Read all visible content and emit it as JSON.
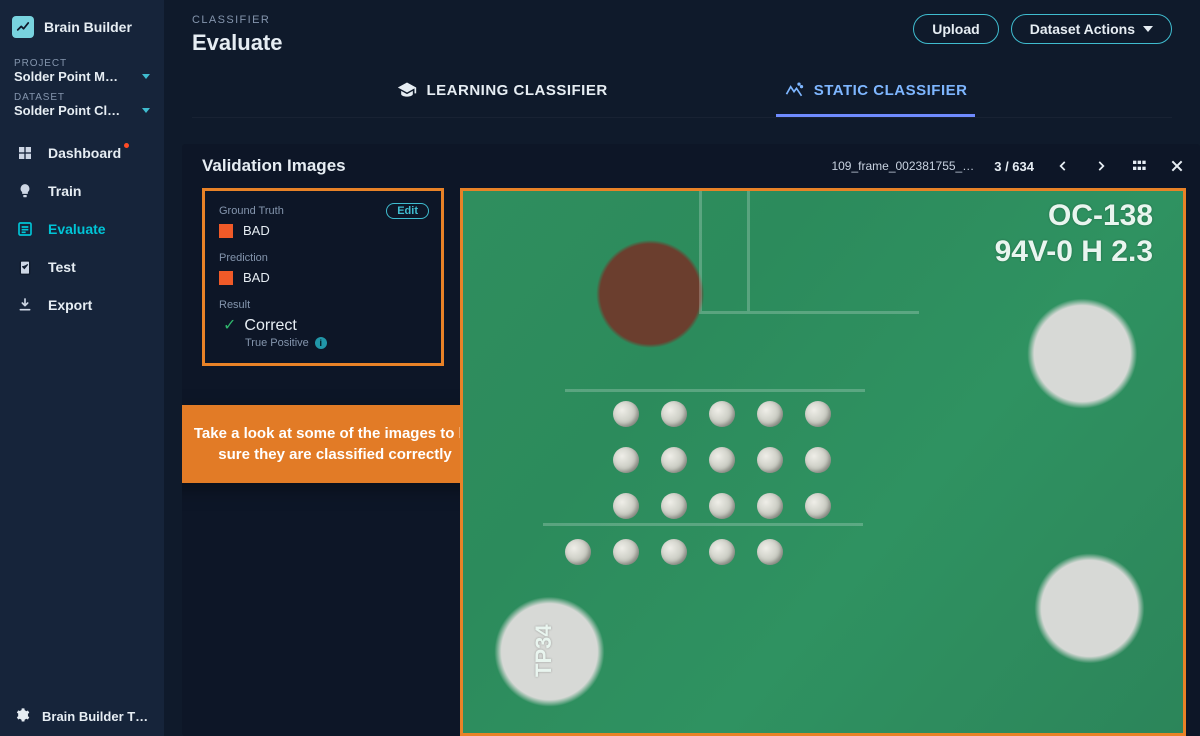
{
  "app": {
    "name": "Brain Builder"
  },
  "sidebarMeta": {
    "projectLabel": "PROJECT",
    "projectValue": "Solder Point M…",
    "datasetLabel": "DATASET",
    "datasetValue": "Solder Point Cl…"
  },
  "nav": {
    "dashboard": "Dashboard",
    "train": "Train",
    "evaluate": "Evaluate",
    "test": "Test",
    "export": "Export"
  },
  "footer": {
    "label": "Brain Builder T…"
  },
  "header": {
    "crumbSmall": "CLASSIFIER",
    "crumbBig": "Evaluate",
    "uploadLabel": "Upload",
    "actionsLabel": "Dataset Actions"
  },
  "tabs": {
    "learning": "LEARNING CLASSIFIER",
    "static": "STATIC CLASSIFIER"
  },
  "panel": {
    "title": "Validation Images",
    "filename": "109_frame_002381755_…",
    "counter": "3 / 634"
  },
  "gt": {
    "groundTruthLabel": "Ground Truth",
    "groundTruthValue": "BAD",
    "predictionLabel": "Prediction",
    "predictionValue": "BAD",
    "resultLabel": "Result",
    "resultValue": "Correct",
    "resultSub": "True Positive",
    "editLabel": "Edit"
  },
  "callout": {
    "text": "Take a look at some of the images to be sure they are classified correctly"
  },
  "pcb": {
    "line1": "OC-138",
    "line2": "94V-0 H 2.3",
    "line3": "TP34"
  }
}
